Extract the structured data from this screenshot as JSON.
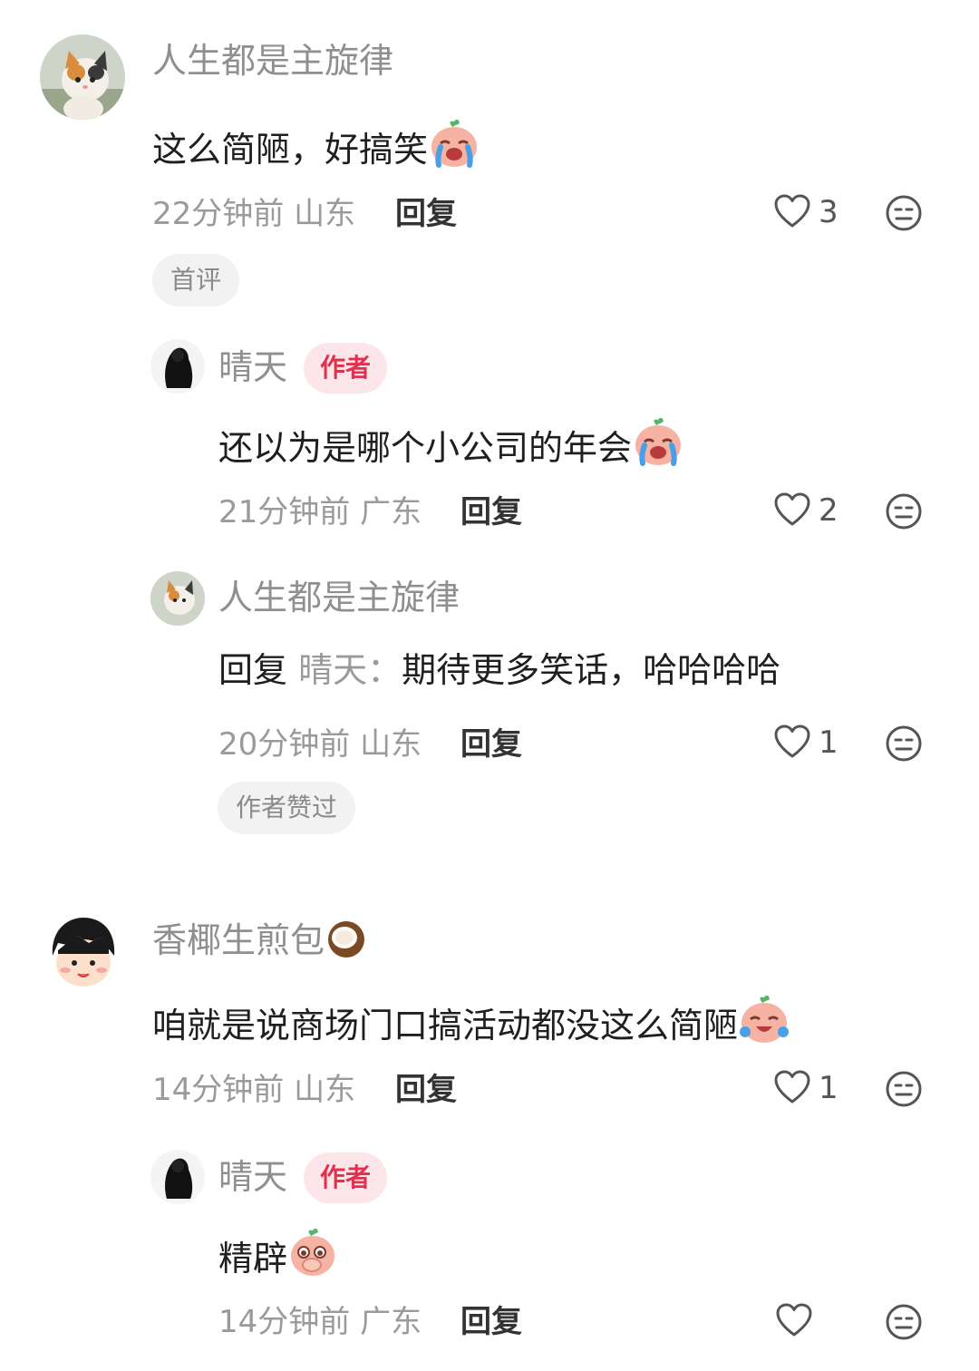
{
  "comments": [
    {
      "user": "人生都是主旋律",
      "text": "这么简陋，好搞笑",
      "emoji": "cry-laugh-emoji",
      "time": "22分钟前",
      "region": "山东",
      "reply_label": "回复",
      "likes": "3",
      "tag": "首评",
      "replies": [
        {
          "user": "晴天",
          "badge": "作者",
          "text": "还以为是哪个小公司的年会",
          "emoji": "cry-laugh-emoji",
          "time": "21分钟前",
          "region": "广东",
          "reply_label": "回复",
          "likes": "2"
        },
        {
          "user": "人生都是主旋律",
          "prefix": "回复",
          "mention": "晴天：",
          "text": "期待更多笑话，哈哈哈哈",
          "time": "20分钟前",
          "region": "山东",
          "reply_label": "回复",
          "likes": "1",
          "tag": "作者赞过"
        }
      ]
    },
    {
      "user": "香椰生煎包",
      "user_emoji": "coconut-emoji",
      "text": "咱就是说商场门口搞活动都没这么简陋",
      "emoji": "laugh-tears-emoji",
      "time": "14分钟前",
      "region": "山东",
      "reply_label": "回复",
      "likes": "1",
      "replies": [
        {
          "user": "晴天",
          "badge": "作者",
          "text": "精辟",
          "emoji": "cover-mouth-emoji",
          "time": "14分钟前",
          "region": "广东",
          "reply_label": "回复",
          "likes": ""
        }
      ]
    }
  ],
  "colors": {
    "name": "#8f8f8f",
    "author_badge_bg": "#fde6ea",
    "author_badge_text": "#e0314f",
    "chip_bg": "#f2f2f2"
  }
}
